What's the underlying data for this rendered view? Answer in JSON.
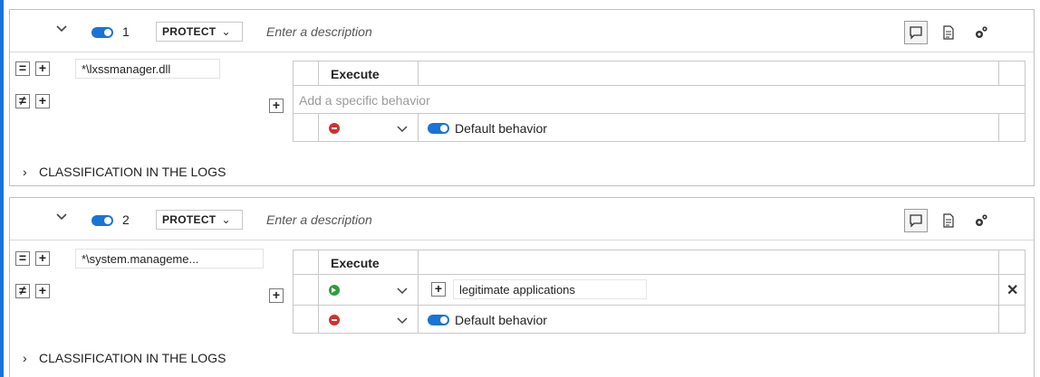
{
  "colors": {
    "accent": "#1a73d8",
    "deny": "#d32f2f",
    "allow": "#2e9d3a"
  },
  "rules": [
    {
      "number": "1",
      "mode": "PROTECT",
      "description_placeholder": "Enter a description",
      "path": "*\\lxssmanager.dll",
      "table_header": "Execute",
      "add_behavior_placeholder": "Add a specific behavior",
      "default_behavior": "Default behavior",
      "classification": "CLASSIFICATION IN THE LOGS"
    },
    {
      "number": "2",
      "mode": "PROTECT",
      "description_placeholder": "Enter a description",
      "path": "*\\system.manageme...",
      "table_header": "Execute",
      "specific_behavior": "legitimate applications",
      "default_behavior": "Default behavior",
      "classification": "CLASSIFICATION IN THE LOGS"
    }
  ],
  "icons": {
    "comment": "comment-icon",
    "document": "document-icon",
    "settings": "settings-gears-icon",
    "allow": "allow-icon",
    "deny": "deny-icon",
    "remove": "remove-icon"
  }
}
